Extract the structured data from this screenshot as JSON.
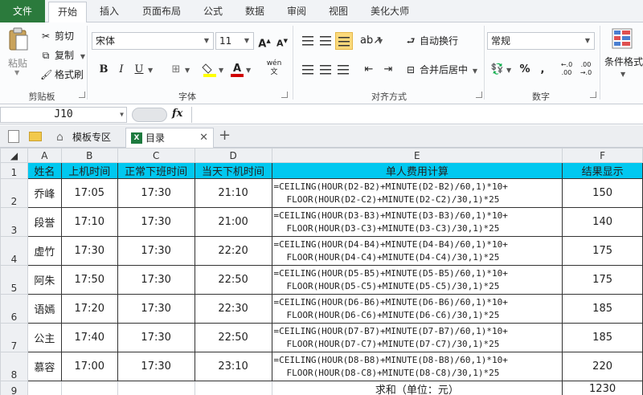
{
  "ribbon_tabs": [
    "文件",
    "开始",
    "插入",
    "页面布局",
    "公式",
    "数据",
    "审阅",
    "视图",
    "美化大师"
  ],
  "clipboard": {
    "paste": "粘贴",
    "cut": "剪切",
    "copy": "复制",
    "format_painter": "格式刷",
    "group": "剪贴板"
  },
  "font": {
    "name": "宋体",
    "size": "11",
    "grow": "A",
    "shrink": "A",
    "bold": "B",
    "italic": "I",
    "underline": "U",
    "group": "字体",
    "font_color": "#d00000",
    "fill_color": "#ffff00"
  },
  "alignment": {
    "wrap": "自动换行",
    "merge": "合并后居中",
    "group": "对齐方式"
  },
  "number": {
    "format": "常规",
    "percent": "%",
    "comma": ",",
    "group": "数字"
  },
  "styles": {
    "conditional": "条件格式"
  },
  "formula_bar": {
    "cell_ref": "J10",
    "fx": "fx"
  },
  "doc_tabs": [
    "模板专区",
    "目录"
  ],
  "sheet": {
    "columns": [
      "A",
      "B",
      "C",
      "D",
      "E",
      "F"
    ],
    "header": [
      "姓名",
      "上机时间",
      "正常下班时间",
      "当天下机时间",
      "单人费用计算",
      "结果显示"
    ],
    "rows": [
      {
        "num": "2",
        "name": "乔峰",
        "start": "17:05",
        "normal": "17:30",
        "end": "21:10",
        "f1": "=CEILING(HOUR(D2-B2)+MINUTE(D2-B2)/60,1)*10+",
        "f2": "FLOOR(HOUR(D2-C2)+MINUTE(D2-C2)/30,1)*25",
        "result": "150"
      },
      {
        "num": "3",
        "name": "段誉",
        "start": "17:10",
        "normal": "17:30",
        "end": "21:00",
        "f1": "=CEILING(HOUR(D3-B3)+MINUTE(D3-B3)/60,1)*10+",
        "f2": "FLOOR(HOUR(D3-C3)+MINUTE(D3-C3)/30,1)*25",
        "result": "140"
      },
      {
        "num": "4",
        "name": "虚竹",
        "start": "17:30",
        "normal": "17:30",
        "end": "22:20",
        "f1": "=CEILING(HOUR(D4-B4)+MINUTE(D4-B4)/60,1)*10+",
        "f2": "FLOOR(HOUR(D4-C4)+MINUTE(D4-C4)/30,1)*25",
        "result": "175"
      },
      {
        "num": "5",
        "name": "阿朱",
        "start": "17:50",
        "normal": "17:30",
        "end": "22:50",
        "f1": "=CEILING(HOUR(D5-B5)+MINUTE(D5-B5)/60,1)*10+",
        "f2": "FLOOR(HOUR(D5-C5)+MINUTE(D5-C5)/30,1)*25",
        "result": "175"
      },
      {
        "num": "6",
        "name": "语嫣",
        "start": "17:20",
        "normal": "17:30",
        "end": "22:30",
        "f1": "=CEILING(HOUR(D6-B6)+MINUTE(D6-B6)/60,1)*10+",
        "f2": "FLOOR(HOUR(D6-C6)+MINUTE(D6-C6)/30,1)*25",
        "result": "185"
      },
      {
        "num": "7",
        "name": "公主",
        "start": "17:40",
        "normal": "17:30",
        "end": "22:50",
        "f1": "=CEILING(HOUR(D7-B7)+MINUTE(D7-B7)/60,1)*10+",
        "f2": "FLOOR(HOUR(D7-C7)+MINUTE(D7-C7)/30,1)*25",
        "result": "185"
      },
      {
        "num": "8",
        "name": "慕容",
        "start": "17:00",
        "normal": "17:30",
        "end": "23:10",
        "f1": "=CEILING(HOUR(D8-B8)+MINUTE(D8-B8)/60,1)*10+",
        "f2": "FLOOR(HOUR(D8-C8)+MINUTE(D8-C8)/30,1)*25",
        "result": "220"
      }
    ],
    "total_label": "求和（单位：元）",
    "total_value": "1230",
    "header_color": "#00c8f0"
  }
}
